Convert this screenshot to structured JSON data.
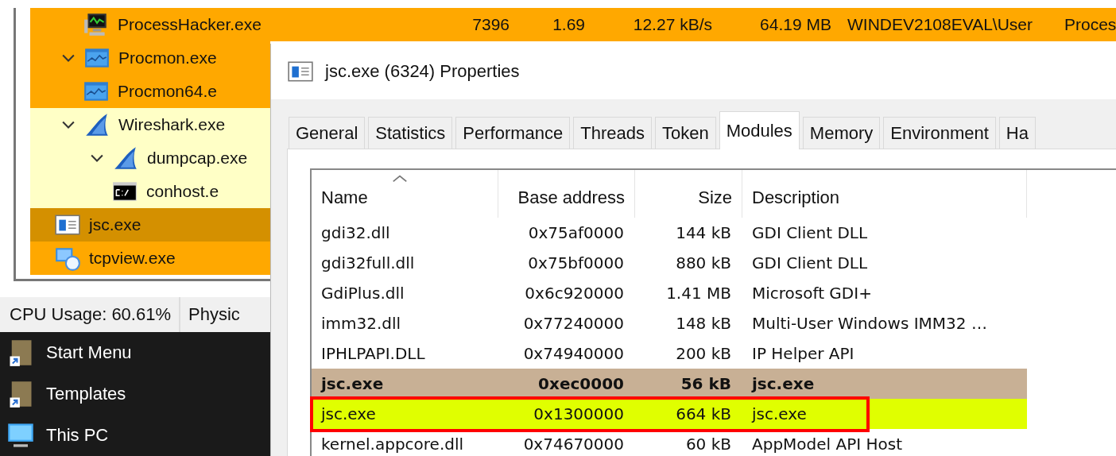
{
  "process_tree": {
    "continued_rows": [
      {
        "name": "ProcessHacker.exe",
        "kind": "monitor",
        "color": "#ffa800",
        "columns": [
          "7396",
          "1.69",
          "12.27 kB/s",
          "64.19 MB",
          "WINDEV2108EVAL\\User",
          "Proces"
        ]
      }
    ],
    "rows": [
      {
        "name": "Procmon.exe",
        "kind": "chart",
        "color": "#ffa800",
        "expanded": true,
        "children": [
          {
            "name": "Procmon64.e",
            "kind": "chart",
            "color": "#ffa800"
          }
        ]
      },
      {
        "name": "Wireshark.exe",
        "kind": "fin",
        "color": "#ffffc6",
        "expanded": true,
        "children": [
          {
            "name": "dumpcap.exe",
            "kind": "fin",
            "color": "#ffffc6",
            "expanded": true,
            "children": [
              {
                "name": "conhost.e",
                "kind": "console",
                "color": "#ffffc6"
              }
            ]
          }
        ]
      },
      {
        "name": "jsc.exe",
        "kind": "window",
        "color": "#d49000"
      },
      {
        "name": "tcpview.exe",
        "kind": "network",
        "color": "#ffa800"
      }
    ]
  },
  "status_bar": [
    "CPU Usage: 60.61%",
    "Physic"
  ],
  "explorer": [
    {
      "name": "Start Menu",
      "kind": "folder"
    },
    {
      "name": "Templates",
      "kind": "folder"
    },
    {
      "name": "This PC",
      "kind": "computer"
    }
  ],
  "dialog": {
    "title": "jsc.exe (6324) Properties",
    "tabs": [
      {
        "label": "General",
        "selected": false
      },
      {
        "label": "Statistics",
        "selected": false
      },
      {
        "label": "Performance",
        "selected": false
      },
      {
        "label": "Threads",
        "selected": false
      },
      {
        "label": "Token",
        "selected": false
      },
      {
        "label": "Modules",
        "selected": true
      },
      {
        "label": "Memory",
        "selected": false
      },
      {
        "label": "Environment",
        "selected": false
      },
      {
        "label": "Ha",
        "selected": false
      }
    ],
    "columns": [
      "Name",
      "Base address",
      "Size",
      "Description"
    ],
    "rows": [
      {
        "name": "gdi32.dll",
        "base": "0x75af0000",
        "size": "144 kB",
        "description": "GDI Client DLL",
        "bold": false,
        "framed": false
      },
      {
        "name": "gdi32full.dll",
        "base": "0x75bf0000",
        "size": "880 kB",
        "description": "GDI Client DLL",
        "bold": false,
        "framed": false
      },
      {
        "name": "GdiPlus.dll",
        "base": "0x6c920000",
        "size": "1.41 MB",
        "description": "Microsoft GDI+",
        "bold": false,
        "framed": false
      },
      {
        "name": "imm32.dll",
        "base": "0x77240000",
        "size": "148 kB",
        "description": "Multi-User Windows IMM32 …",
        "bold": false,
        "framed": false
      },
      {
        "name": "IPHLPAPI.DLL",
        "base": "0x74940000",
        "size": "200 kB",
        "description": "IP Helper API",
        "bold": false,
        "framed": false
      },
      {
        "name": "jsc.exe",
        "base": "0xec0000",
        "size": "56 kB",
        "description": "jsc.exe",
        "bold": true,
        "framed": false,
        "color": "#c8b095"
      },
      {
        "name": "jsc.exe",
        "base": "0x1300000",
        "size": "664 kB",
        "description": "jsc.exe",
        "bold": false,
        "framed": true,
        "color": "#e0ff00"
      },
      {
        "name": "kernel.appcore.dll",
        "base": "0x74670000",
        "size": "60 kB",
        "description": "AppModel API Host",
        "bold": false,
        "framed": false
      }
    ]
  }
}
